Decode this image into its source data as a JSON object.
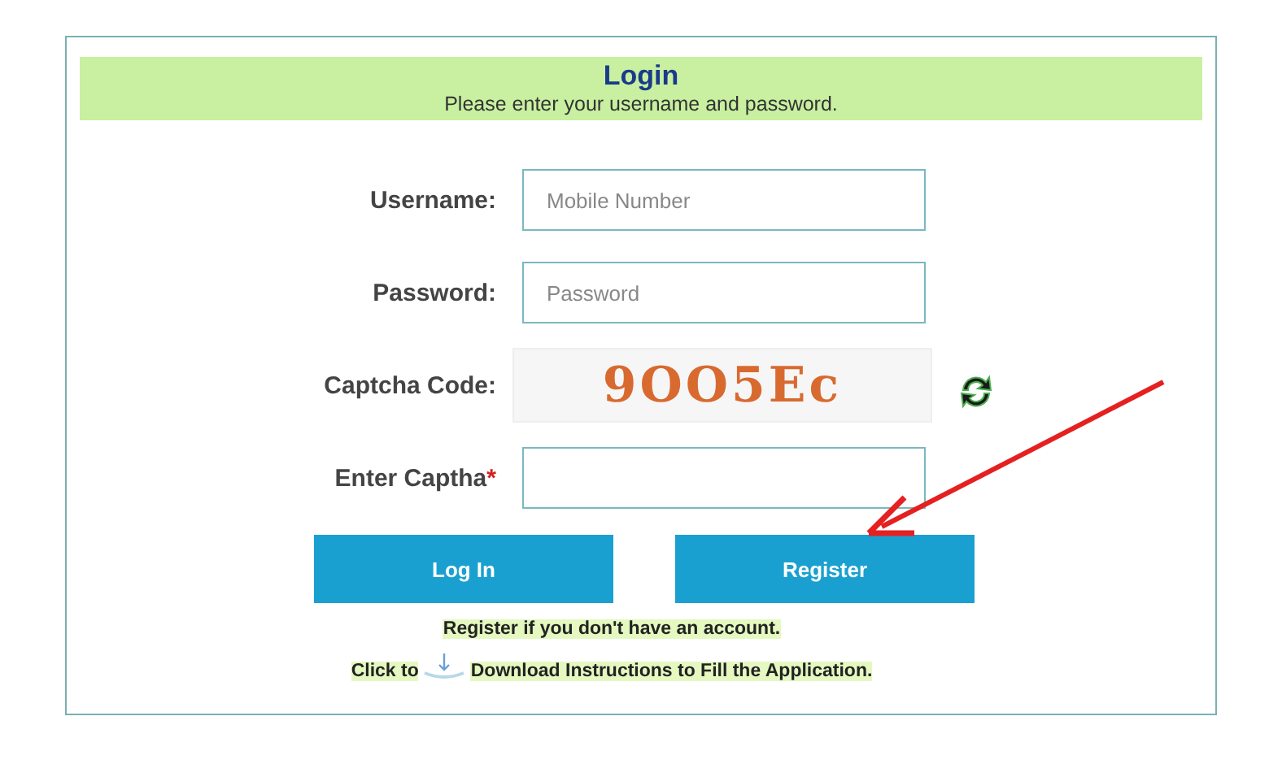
{
  "header": {
    "title": "Login",
    "subtitle": "Please enter your username and password."
  },
  "fields": [
    {
      "kind": "input",
      "label": "Username:",
      "placeholder": "Mobile Number"
    },
    {
      "kind": "input",
      "label": "Password:",
      "placeholder": "Password"
    },
    {
      "kind": "captcha",
      "label": "Captcha Code:",
      "code": "9OO5Ec"
    },
    {
      "kind": "input",
      "label": "Enter Captha",
      "required_mark": "*"
    }
  ],
  "buttons": [
    "Log In",
    "Register"
  ],
  "register_note": "Register if you don't have an account.",
  "download_note": {
    "before": "Click to",
    "after": "Download Instructions to Fill the Application."
  }
}
